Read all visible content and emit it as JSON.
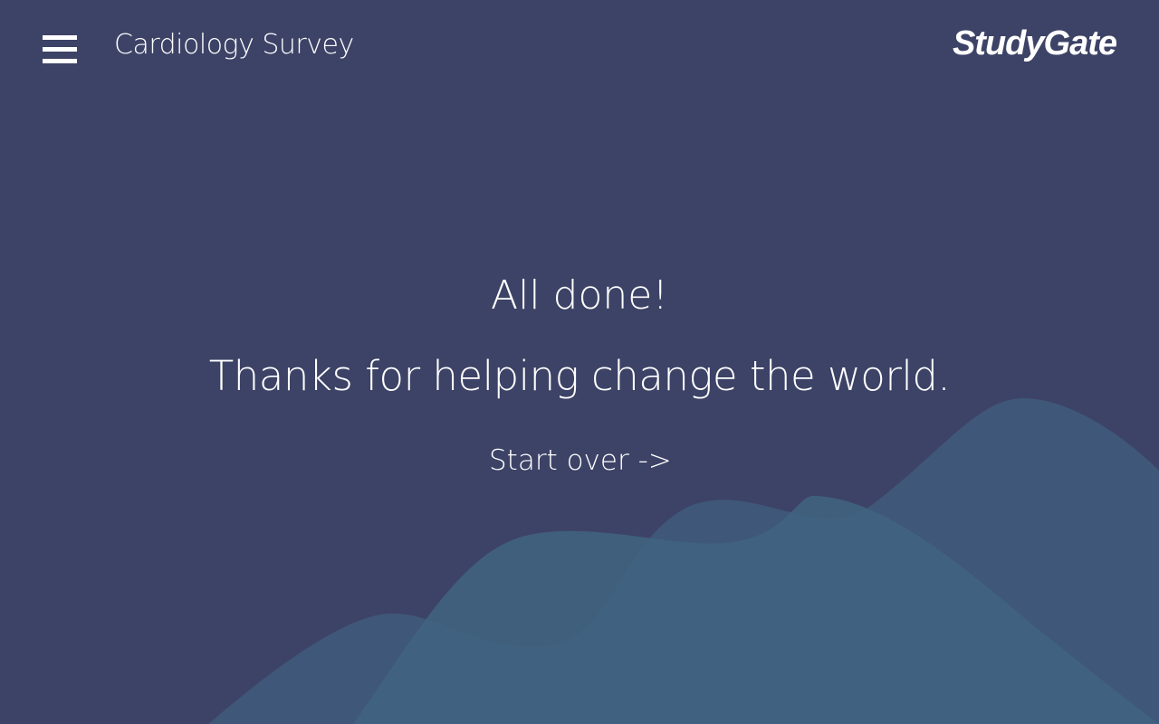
{
  "header": {
    "menu_icon": "hamburger-menu-icon",
    "title": "Cardiology Survey",
    "brand": "StudyGate"
  },
  "main": {
    "heading": "All done!",
    "subheading": "Thanks for helping change the world.",
    "start_over_label": "Start over ->"
  },
  "colors": {
    "background": "#3d4366",
    "wave_back": "#3f587a",
    "wave_front": "#40637f",
    "text": "#ffffff"
  }
}
